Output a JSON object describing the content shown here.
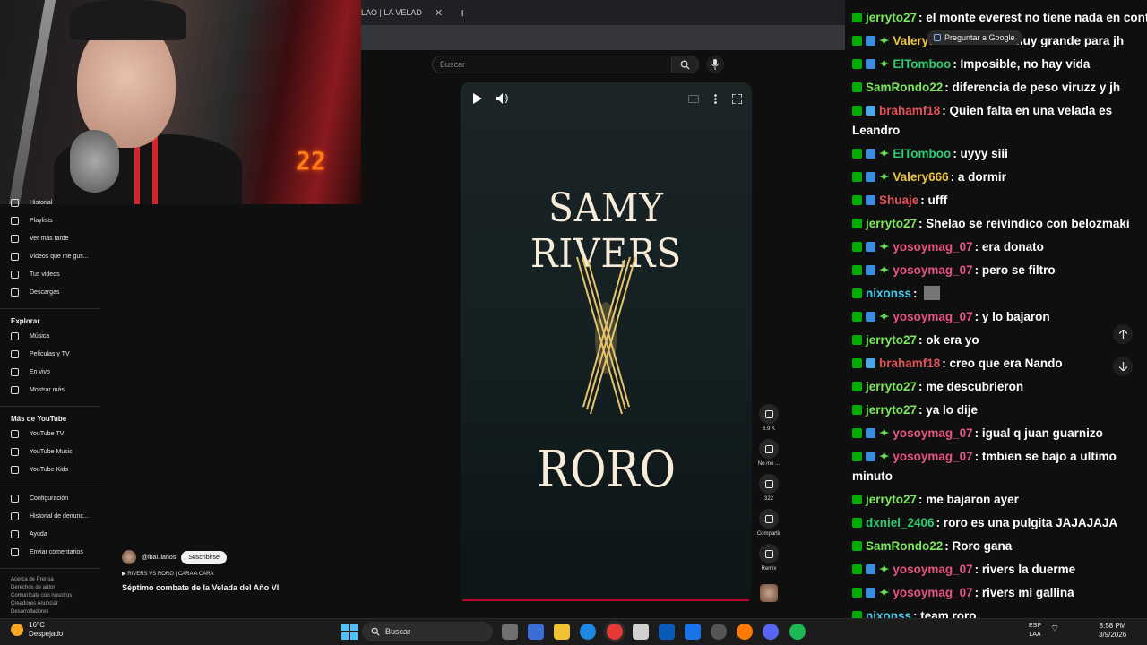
{
  "browser": {
    "tab_title": "LAO | LA VELAD",
    "close_label": "✕",
    "new_tab_label": "+",
    "google_overlay": "Preguntar a Google"
  },
  "youtube": {
    "search_placeholder": "Buscar",
    "sidebar": {
      "items_top": [
        {
          "label": "Historial",
          "icon": "history-icon"
        },
        {
          "label": "Playlists",
          "icon": "playlist-icon"
        },
        {
          "label": "Ver más tarde",
          "icon": "clock-icon"
        },
        {
          "label": "Videos que me gus...",
          "icon": "like-icon"
        },
        {
          "label": "Tus videos",
          "icon": "video-icon"
        },
        {
          "label": "Descargas",
          "icon": "download-icon"
        }
      ],
      "explore_heading": "Explorar",
      "explore_items": [
        {
          "label": "Música",
          "icon": "music-icon"
        },
        {
          "label": "Películas y TV",
          "icon": "film-icon"
        },
        {
          "label": "En vivo",
          "icon": "live-icon"
        },
        {
          "label": "Mostrar más",
          "icon": "chevron-down-icon"
        }
      ],
      "more_heading": "Más de YouTube",
      "more_items": [
        {
          "label": "YouTube TV",
          "icon": "youtube-tv-icon"
        },
        {
          "label": "YouTube Music",
          "icon": "youtube-music-icon"
        },
        {
          "label": "YouTube Kids",
          "icon": "youtube-kids-icon"
        }
      ],
      "settings_items": [
        {
          "label": "Configuración",
          "icon": "gear-icon"
        },
        {
          "label": "Historial de denunc...",
          "icon": "flag-icon"
        },
        {
          "label": "Ayuda",
          "icon": "help-icon"
        },
        {
          "label": "Enviar comentarios",
          "icon": "feedback-icon"
        }
      ],
      "footer_lines": [
        "Acerca de  Prensa",
        "Derechos de autor",
        "Comunícate con nosotros",
        "Creadores  Anunciar",
        "Desarrolladores"
      ]
    },
    "video": {
      "title_top": "SAMY RIVERS",
      "title_bottom": "RORO",
      "actions": [
        {
          "label": "6.9 K",
          "icon": "like-icon"
        },
        {
          "label": "No me ...",
          "icon": "dislike-icon"
        },
        {
          "label": "322",
          "icon": "comment-icon"
        },
        {
          "label": "Compartir",
          "icon": "share-icon"
        },
        {
          "label": "Remix",
          "icon": "remix-icon"
        }
      ]
    },
    "channel": {
      "handle": "@ibai.llanos",
      "subscribe_label": "Suscribirse",
      "mini_title": "RIVERS VS RORO | CARA A CARA",
      "title": "Séptimo combate de la Velada del Año VI"
    }
  },
  "webcam": {
    "clock": "22"
  },
  "chat": {
    "messages": [
      {
        "badges": [
          "g"
        ],
        "user": "jerryto27",
        "color": "#7ce65c",
        "text": ": el monte everest no tiene nada en contra de mi"
      },
      {
        "badges": [
          "g",
          "b",
          "s"
        ],
        "user": "Valery666",
        "color": "#f0c640",
        "text": ": viruzz es muy grande para jh"
      },
      {
        "badges": [
          "g",
          "b",
          "s"
        ],
        "user": "ElTomboo",
        "color": "#2ecc71",
        "text": ": Imposible, no hay vida"
      },
      {
        "badges": [
          "g"
        ],
        "user": "SamRondo22",
        "color": "#7ce65c",
        "text": ": diferencia de peso viruzz y jh"
      },
      {
        "badges": [
          "g",
          "c"
        ],
        "user": "brahamf18",
        "color": "#e0535a",
        "text": ": Quien falta en una velada es",
        "cont": "Leandro"
      },
      {
        "badges": [
          "g",
          "b",
          "s"
        ],
        "user": "ElTomboo",
        "color": "#2ecc71",
        "text": ": uyyy siii"
      },
      {
        "badges": [
          "g",
          "b",
          "s"
        ],
        "user": "Valery666",
        "color": "#f0c640",
        "text": ": a dormir"
      },
      {
        "badges": [
          "g",
          "b"
        ],
        "user": "Shuaje",
        "color": "#e0535a",
        "text": ": ufff"
      },
      {
        "badges": [
          "g"
        ],
        "user": "jerryto27",
        "color": "#7ce65c",
        "text": ": Shelao se reivindico con belozmaki"
      },
      {
        "badges": [
          "g",
          "b",
          "s"
        ],
        "user": "yosoymag_07",
        "color": "#e75480",
        "text": ": era donato"
      },
      {
        "badges": [
          "g",
          "b",
          "s"
        ],
        "user": "yosoymag_07",
        "color": "#e75480",
        "text": ": pero se filtro"
      },
      {
        "badges": [
          "g"
        ],
        "user": "nixonss",
        "color": "#42c9e8",
        "text": ": ",
        "emote": true
      },
      {
        "badges": [
          "g",
          "b",
          "s"
        ],
        "user": "yosoymag_07",
        "color": "#e75480",
        "text": ": y lo bajaron"
      },
      {
        "badges": [
          "g"
        ],
        "user": "jerryto27",
        "color": "#7ce65c",
        "text": ": ok era yo"
      },
      {
        "badges": [
          "g",
          "c"
        ],
        "user": "brahamf18",
        "color": "#e0535a",
        "text": ": creo que era Nando"
      },
      {
        "badges": [
          "g"
        ],
        "user": "jerryto27",
        "color": "#7ce65c",
        "text": ": me descubrieron"
      },
      {
        "badges": [
          "g"
        ],
        "user": "jerryto27",
        "color": "#7ce65c",
        "text": ": ya lo dije"
      },
      {
        "badges": [
          "g",
          "b",
          "s"
        ],
        "user": "yosoymag_07",
        "color": "#e75480",
        "text": ": igual q juan guarnizo"
      },
      {
        "badges": [
          "g",
          "b",
          "s"
        ],
        "user": "yosoymag_07",
        "color": "#e75480",
        "text": ": tmbien se bajo a ultimo",
        "cont": "minuto"
      },
      {
        "badges": [
          "g"
        ],
        "user": "jerryto27",
        "color": "#7ce65c",
        "text": ": me bajaron ayer"
      },
      {
        "badges": [
          "g"
        ],
        "user": "dxniel_2406",
        "color": "#2ecc71",
        "text": ": roro es una pulgita JAJAJAJA"
      },
      {
        "badges": [
          "g"
        ],
        "user": "SamRondo22",
        "color": "#7ce65c",
        "text": ": Roro gana"
      },
      {
        "badges": [
          "g",
          "b",
          "s"
        ],
        "user": "yosoymag_07",
        "color": "#e75480",
        "text": ": rivers la duerme"
      },
      {
        "badges": [
          "g",
          "b",
          "s"
        ],
        "user": "yosoymag_07",
        "color": "#e75480",
        "text": ": rivers mi gallina"
      },
      {
        "badges": [
          "g"
        ],
        "user": "nixonss",
        "color": "#42c9e8",
        "text": ": team roro"
      }
    ]
  },
  "taskbar": {
    "weather_temp": "16°C",
    "weather_desc": "Despejado",
    "search_label": "Buscar",
    "lang_top": "ESP",
    "lang_bottom": "LAA",
    "time": "8:58 PM",
    "date": "3/9/2026"
  }
}
